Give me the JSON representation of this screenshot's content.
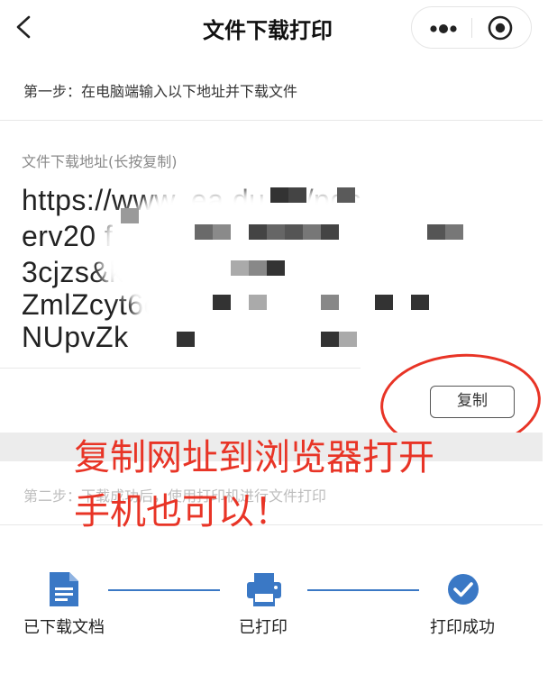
{
  "header": {
    "title": "文件下载打印",
    "back_icon": "chevron-left-icon",
    "more_icon": "more-dots-icon",
    "target_icon": "target-icon"
  },
  "step1": {
    "text": "第一步：在电脑端输入以下地址并下载文件"
  },
  "url_section": {
    "label": "文件下载地址(长按复制)",
    "lines": [
      "https://www.  ea         du.cn/pgs",
      "erv20                          f         gk",
      "3cjzs&ksid=                       208w",
      "ZmlZcyt6cF                           w",
      "NUpvZk"
    ]
  },
  "copy_button": {
    "label": "复制"
  },
  "step2": {
    "text": "第二步：下载成功后，使用打印机进行文件打印"
  },
  "annotation": {
    "line1": "复制网址到浏览器打开",
    "line2": "手机也可以！"
  },
  "progress": {
    "steps": [
      {
        "label": "已下载文档",
        "icon": "document-icon"
      },
      {
        "label": "已打印",
        "icon": "printer-icon"
      },
      {
        "label": "打印成功",
        "icon": "check-circle-icon"
      }
    ]
  },
  "colors": {
    "accent": "#3a78c5",
    "annotation": "#e83426"
  }
}
